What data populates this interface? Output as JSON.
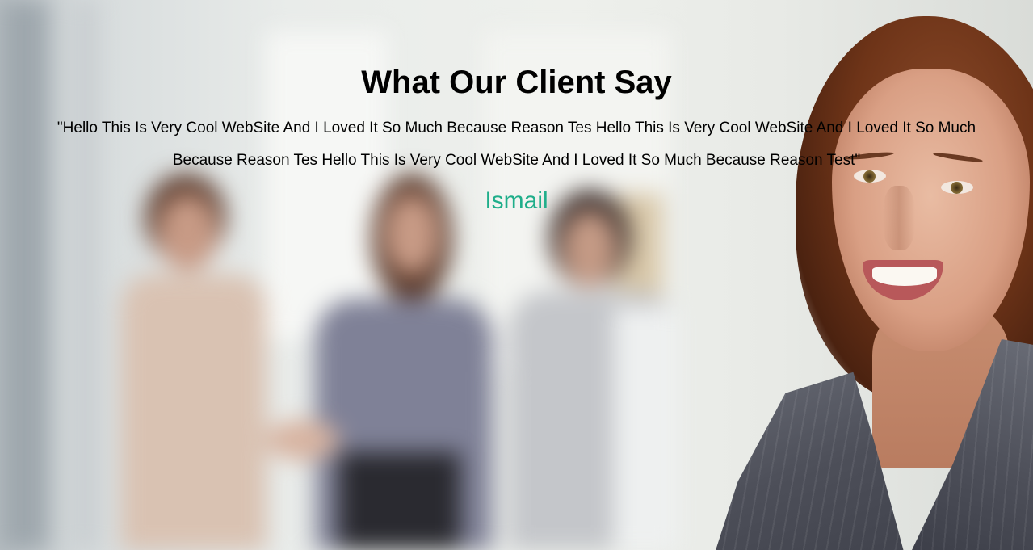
{
  "testimonial": {
    "heading": "What Our Client Say",
    "quote": "\"Hello This Is Very Cool WebSite And I Loved It So Much Because Reason Tes Hello This Is Very Cool WebSite And I Loved It So Much Because Reason Tes Hello This Is Very Cool WebSite And I Loved It So Much Because Reason Test\"",
    "author": "Ismail"
  },
  "colors": {
    "heading": "#000000",
    "quote": "#000000",
    "author": "#1fae8a"
  }
}
